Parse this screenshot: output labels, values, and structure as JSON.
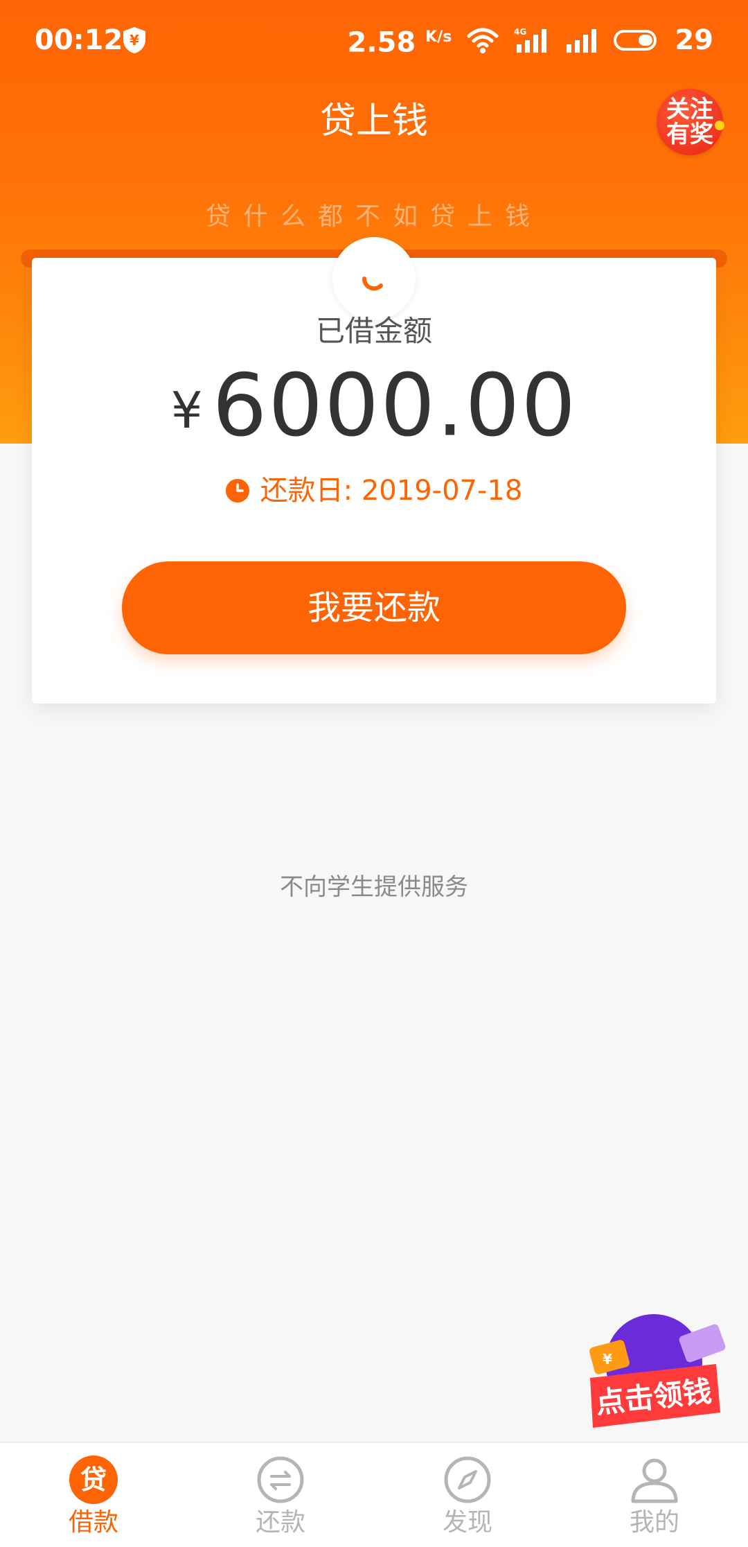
{
  "status_bar": {
    "time": "00:12",
    "speed_value": "2.58",
    "speed_unit": "K/s",
    "network_label": "4G",
    "battery_level": "29"
  },
  "header": {
    "title": "贷上钱",
    "follow_badge_line1": "关注",
    "follow_badge_line2": "有奖",
    "slogan": "贷什么都不如贷上钱"
  },
  "loan_card": {
    "label": "已借金额",
    "currency_symbol": "¥",
    "amount": "6000.00",
    "due_text": "还款日: 2019-07-18",
    "repay_button": "我要还款"
  },
  "notice": "不向学生提供服务",
  "promo": {
    "label": "点击领钱"
  },
  "tab_bar": {
    "tabs": [
      {
        "label": "借款",
        "icon": "loan-icon",
        "active": true,
        "icon_char": "贷"
      },
      {
        "label": "还款",
        "icon": "repay-icon",
        "active": false
      },
      {
        "label": "发现",
        "icon": "compass-icon",
        "active": false
      },
      {
        "label": "我的",
        "icon": "profile-icon",
        "active": false
      }
    ]
  },
  "colors": {
    "brand": "#ff6404",
    "brand_light": "#ff9c0f",
    "background": "#f7f7f7",
    "inactive": "#b5b5b5"
  }
}
